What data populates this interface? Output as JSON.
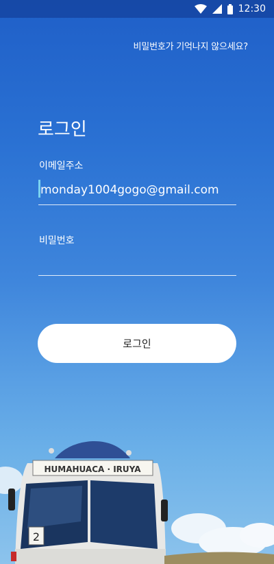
{
  "status_bar": {
    "time": "12:30",
    "icons": [
      "wifi-icon",
      "cell-signal-icon",
      "battery-icon"
    ]
  },
  "forgot_password_link": "비밀번호가 기억나지 않으세요?",
  "title": "로그인",
  "email": {
    "label": "이메일주소",
    "value": "monday1004gogo@gmail.com"
  },
  "password": {
    "label": "비밀번호",
    "value": ""
  },
  "login_button": "로그인",
  "background": {
    "bus_sign": "HUMAHUACA · IRUYA",
    "bus_number": "2"
  },
  "colors": {
    "sky_top": "#1f5fc8",
    "sky_bottom": "#8cc3ec",
    "button_bg": "#ffffff",
    "caret": "#7ad3f0"
  }
}
